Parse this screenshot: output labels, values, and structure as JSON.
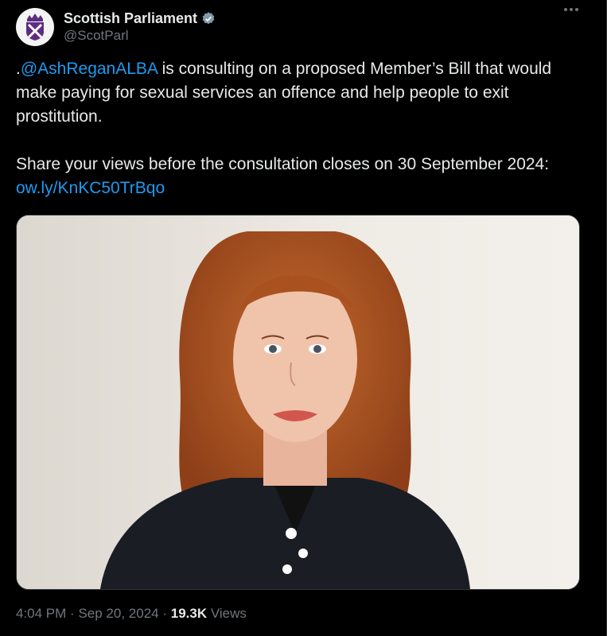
{
  "account": {
    "display_name": "Scottish Parliament",
    "handle": "@ScotParl",
    "verified_icon": "verified-badge-icon"
  },
  "post": {
    "prefix": ".",
    "mention": "@AshReganALBA",
    "text_1": " is consulting on a proposed Member’s Bill that would make paying for sexual services an offence and help people to exit prostitution.",
    "text_2": "Share your views before the consultation closes on 30 September 2024: ",
    "link": "ow.ly/KnKC50TrBqo"
  },
  "meta": {
    "time": "4:04 PM",
    "separator": "·",
    "date": "Sep 20, 2024",
    "views_count": "19.3K",
    "views_label": " Views"
  },
  "colors": {
    "background": "#000000",
    "link": "#1d9bf0",
    "muted": "#71767b",
    "verified": "#829aab"
  }
}
